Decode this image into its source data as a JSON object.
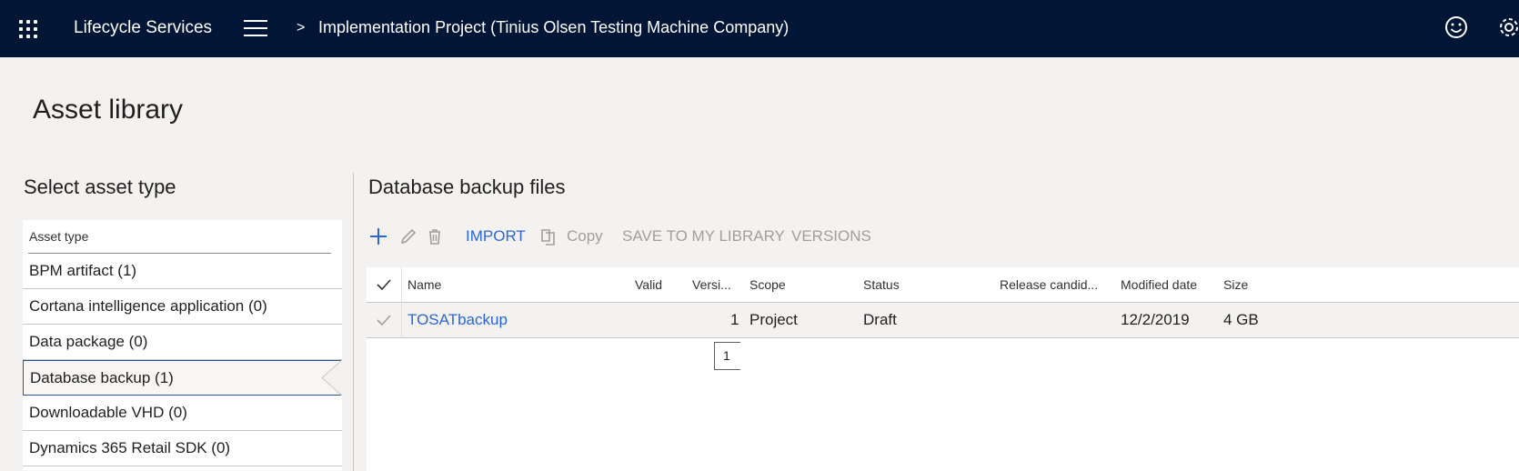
{
  "header": {
    "app_title": "Lifecycle Services",
    "breadcrumb_separator": ">",
    "project_title": "Implementation Project (Tinius Olsen Testing Machine Company)",
    "icons": [
      "waffle-icon",
      "hamburger-icon",
      "smiley-icon",
      "gear-icon"
    ]
  },
  "page": {
    "title": "Asset library"
  },
  "asset_types": {
    "heading": "Select asset type",
    "column_header": "Asset type",
    "items": [
      {
        "label": "BPM artifact (1)"
      },
      {
        "label": "Cortana intelligence application (0)"
      },
      {
        "label": "Data package (0)"
      },
      {
        "label": "Database backup (1)",
        "selected": true
      },
      {
        "label": "Downloadable VHD (0)"
      },
      {
        "label": "Dynamics 365 Retail SDK (0)"
      }
    ]
  },
  "files": {
    "heading": "Database backup files",
    "toolbar": {
      "import_label": "IMPORT",
      "copy_label": "Copy",
      "save_label": "SAVE TO MY LIBRARY",
      "versions_label": "VERSIONS",
      "icons": [
        "add-icon",
        "edit-icon",
        "delete-icon",
        "copy-icon"
      ]
    },
    "columns": {
      "name": "Name",
      "valid": "Valid",
      "version": "Versi...",
      "scope": "Scope",
      "status": "Status",
      "release": "Release candid...",
      "modified": "Modified date",
      "size": "Size"
    },
    "rows": [
      {
        "name": "TOSATbackup",
        "valid": "",
        "version": "1",
        "scope": "Project",
        "status": "Draft",
        "release": "",
        "modified": "12/2/2019",
        "size": "4 GB"
      }
    ],
    "page_number": "1"
  },
  "colors": {
    "topbar": "#011637",
    "background": "#f3f2f1",
    "link": "#2b66d8",
    "disabled": "#a19f9d",
    "selection_border": "#2b579a"
  }
}
